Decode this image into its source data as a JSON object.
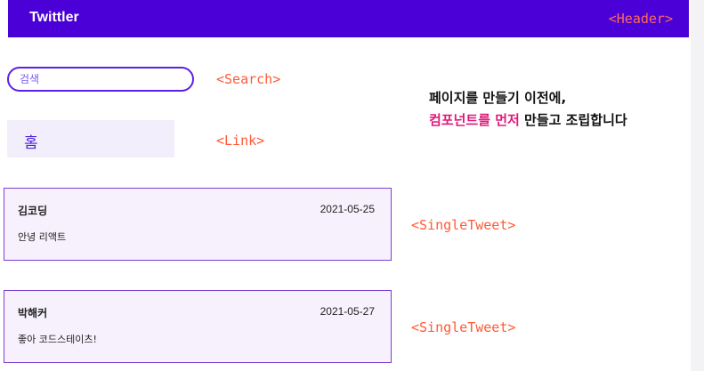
{
  "header": {
    "title": "Twittler",
    "component_label": "<Header>"
  },
  "search": {
    "placeholder": "검색",
    "component_label": "<Search>"
  },
  "link": {
    "label": "홈",
    "component_label": "<Link>"
  },
  "tweets": [
    {
      "author": "김코딩",
      "date": "2021-05-25",
      "content": "안녕 리액트",
      "component_label": "<SingleTweet>"
    },
    {
      "author": "박해커",
      "date": "2021-05-27",
      "content": "좋아 코드스테이츠!",
      "component_label": "<SingleTweet>"
    }
  ],
  "description": {
    "line1": "페이지를 만들기 이전에,",
    "line2_highlight": "컴포넌트를 먼저",
    "line2_rest": " 만들고 조립합니다"
  },
  "colors": {
    "header_bg": "#4a00d6",
    "label_color": "#ff5a36",
    "highlight": "#e0197a",
    "tweet_border": "#7b3fd0",
    "tweet_bg": "#f6f1fd"
  }
}
